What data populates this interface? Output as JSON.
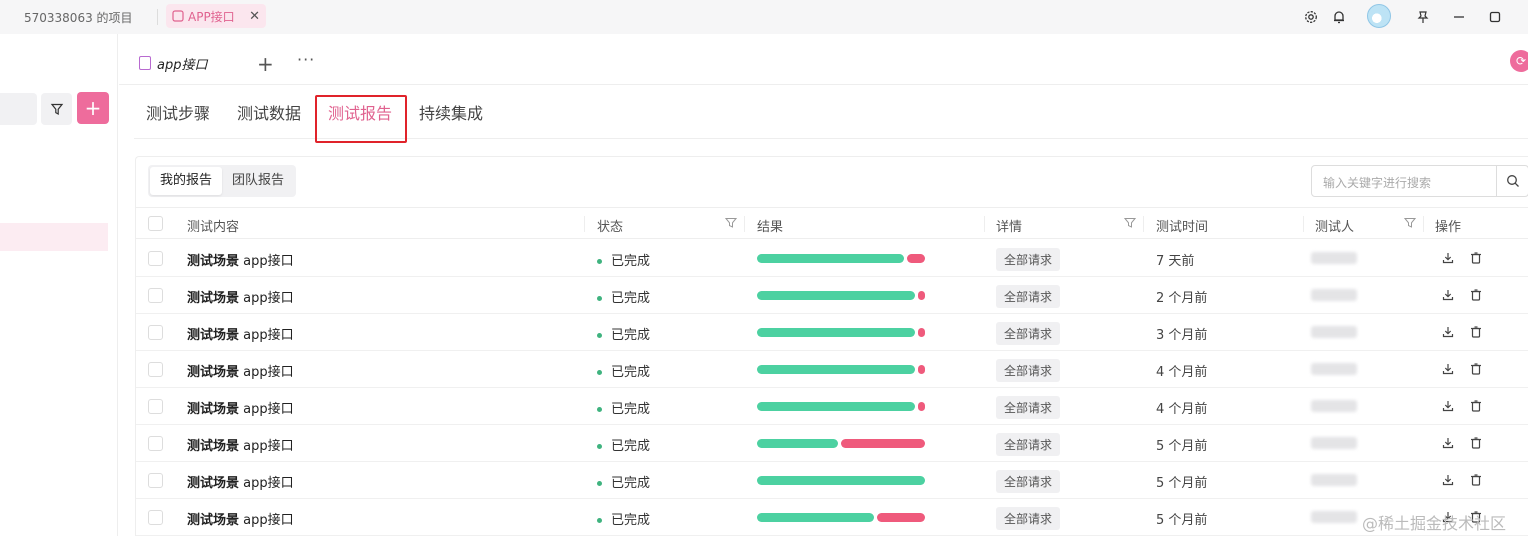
{
  "topbar": {
    "project_label": "570338063 的项目",
    "active_tab_label": "APP接口",
    "close_glyph": "✕"
  },
  "doc": {
    "tab_label": "app接口",
    "plus": "+",
    "more": "···"
  },
  "subtabs": [
    "测试步骤",
    "测试数据",
    "测试报告",
    "持续集成"
  ],
  "segments": [
    "我的报告",
    "团队报告"
  ],
  "search": {
    "placeholder": "输入关键字进行搜索"
  },
  "table": {
    "headers": {
      "content": "测试内容",
      "status": "状态",
      "result": "结果",
      "detail": "详情",
      "time": "测试时间",
      "tester": "测试人",
      "actions": "操作"
    },
    "rows": [
      {
        "kind": "测试场景",
        "name": "app接口",
        "status": "已完成",
        "pass": 0.89,
        "fail": 0.11,
        "detail": "全部请求",
        "time": "7 天前"
      },
      {
        "kind": "测试场景",
        "name": "app接口",
        "status": "已完成",
        "pass": 0.96,
        "fail": 0.04,
        "detail": "全部请求",
        "time": "2 个月前"
      },
      {
        "kind": "测试场景",
        "name": "app接口",
        "status": "已完成",
        "pass": 0.96,
        "fail": 0.04,
        "detail": "全部请求",
        "time": "3 个月前"
      },
      {
        "kind": "测试场景",
        "name": "app接口",
        "status": "已完成",
        "pass": 0.96,
        "fail": 0.04,
        "detail": "全部请求",
        "time": "4 个月前"
      },
      {
        "kind": "测试场景",
        "name": "app接口",
        "status": "已完成",
        "pass": 0.96,
        "fail": 0.04,
        "detail": "全部请求",
        "time": "4 个月前"
      },
      {
        "kind": "测试场景",
        "name": "app接口",
        "status": "已完成",
        "pass": 0.49,
        "fail": 0.51,
        "detail": "全部请求",
        "time": "5 个月前"
      },
      {
        "kind": "测试场景",
        "name": "app接口",
        "status": "已完成",
        "pass": 1.0,
        "fail": 0.0,
        "detail": "全部请求",
        "time": "5 个月前"
      },
      {
        "kind": "测试场景",
        "name": "app接口",
        "status": "已完成",
        "pass": 0.71,
        "fail": 0.29,
        "detail": "全部请求",
        "time": "5 个月前"
      }
    ]
  },
  "watermark": "@稀土掘金技术社区",
  "colors": {
    "accent": "#e0628f",
    "pass": "#4cd1a1",
    "fail": "#ef5a7c",
    "status_dot": "#3fb37f"
  }
}
